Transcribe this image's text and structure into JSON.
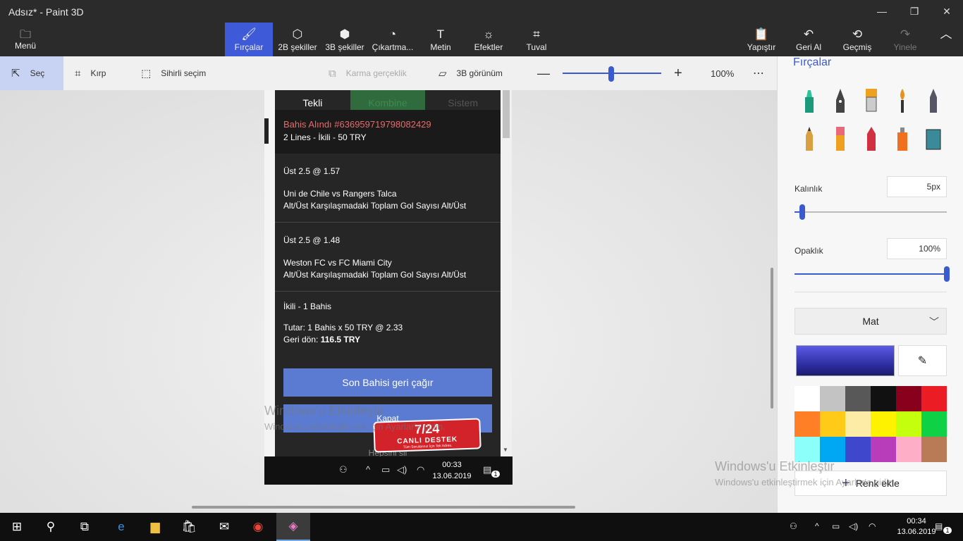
{
  "window": {
    "title": "Adsız* - Paint 3D"
  },
  "ribbon": {
    "menu_label": "Menü",
    "tools": [
      {
        "label": "Fırçalar",
        "icon": "brush-icon"
      },
      {
        "label": "2B şekiller",
        "icon": "shapes-2d-icon"
      },
      {
        "label": "3B şekiller",
        "icon": "cube-icon"
      },
      {
        "label": "Çıkartma...",
        "icon": "sticker-icon"
      },
      {
        "label": "Metin",
        "icon": "text-icon"
      },
      {
        "label": "Efektler",
        "icon": "effects-icon"
      },
      {
        "label": "Tuval",
        "icon": "canvas-icon"
      }
    ],
    "actions": [
      {
        "label": "Yapıştır",
        "icon": "paste-icon"
      },
      {
        "label": "Geri Al",
        "icon": "undo-icon"
      },
      {
        "label": "Geçmiş",
        "icon": "history-icon"
      },
      {
        "label": "Yinele",
        "icon": "redo-icon"
      }
    ]
  },
  "toolbar": {
    "select_label": "Seç",
    "crop_label": "Kırp",
    "magic_select_label": "Sihirli seçim",
    "mixed_reality_label": "Karma gerçeklik",
    "view3d_label": "3B görünüm",
    "zoom_value": "100%"
  },
  "bet_slip": {
    "tabs": [
      "Tekli",
      "Kombine",
      "Sistem"
    ],
    "received_title": "Bahis Alındı #636959719798082429",
    "received_sub": "2 Lines - İkili - 50 TRY",
    "selections": [
      {
        "pick": "Üst  2.5  @ 1.57",
        "match": "Uni de Chile vs Rangers Talca",
        "market": "Alt/Üst Karşılaşmadaki Toplam Gol Sayısı Alt/Üst"
      },
      {
        "pick": "Üst  2.5  @ 1.48",
        "match": "Weston FC vs FC Miami City",
        "market": "Alt/Üst Karşılaşmadaki Toplam Gol Sayısı Alt/Üst"
      }
    ],
    "summary_title": "İkili - 1 Bahis",
    "stake_line": "Tutar:  1 Bahis x 50 TRY  @ 2.33",
    "return_label": "Geri dön:",
    "return_value": "116.5 TRY",
    "recall_button": "Son Bahisi geri çağır",
    "close_button": "Kapat",
    "clear_link": "Hepsini sil"
  },
  "live_support": {
    "line1": "7/24",
    "line2": "CANLI DESTEK",
    "line3": "Tüm Sorularınız İçin Tek Adres."
  },
  "inner_taskbar": {
    "time": "00:33",
    "date": "13.06.2019",
    "notif": "1"
  },
  "watermark": {
    "title": "Windows'u Etkinleştir",
    "subtitle": "Windows'u etkinleştirmek için Ayarlar'a gidin."
  },
  "panel": {
    "title": "Fırçalar",
    "brushes": [
      {
        "icon": "marker-icon",
        "color": "#1a9a7a"
      },
      {
        "icon": "calligraphy-pen-icon",
        "color": "#444444"
      },
      {
        "icon": "oil-brush-icon",
        "color": "#f0a020"
      },
      {
        "icon": "watercolor-icon",
        "color": "#e89020"
      },
      {
        "icon": "pixel-pen-icon",
        "color": "#555566"
      },
      {
        "icon": "pencil-icon",
        "color": "#d8a040"
      },
      {
        "icon": "eraser-icon",
        "color": "#e86a7a"
      },
      {
        "icon": "crayon-icon",
        "color": "#d03040"
      },
      {
        "icon": "spray-can-icon",
        "color": "#f07020"
      },
      {
        "icon": "fill-bucket-icon",
        "color": "#3a8a9a"
      }
    ],
    "thickness_label": "Kalınlık",
    "thickness_value": "5px",
    "thickness_level": 0.05,
    "opacity_label": "Opaklık",
    "opacity_value": "100%",
    "opacity_level": 1.0,
    "finish_value": "Mat",
    "palette": [
      "#ffffff",
      "#c3c3c3",
      "#585858",
      "#111111",
      "#88001b",
      "#ec1c24",
      "#ff7f27",
      "#ffca18",
      "#fdeca6",
      "#fff200",
      "#c4ff0e",
      "#0ed145",
      "#8cfffb",
      "#00a8f3",
      "#3f48cc",
      "#b83dba",
      "#ffaec8",
      "#b97a56"
    ],
    "add_color_label": "Renk ekle"
  },
  "taskbar": {
    "apps": [
      "start-icon",
      "search-icon",
      "task-view-icon",
      "edge-icon",
      "file-explorer-icon",
      "store-icon",
      "mail-icon",
      "chrome-icon",
      "paint3d-icon"
    ],
    "time": "00:34",
    "date": "13.06.2019",
    "notif": "1"
  }
}
